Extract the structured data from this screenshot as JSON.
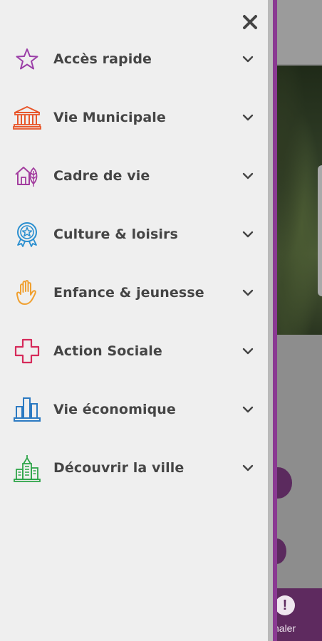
{
  "drawer": {
    "close_icon": "close-icon",
    "items": [
      {
        "label": "Accès rapide",
        "icon": "star-icon",
        "color": "#9b3ea7"
      },
      {
        "label": "Vie Municipale",
        "icon": "town-hall-icon",
        "color": "#e8562a"
      },
      {
        "label": "Cadre de vie",
        "icon": "house-leaf-icon",
        "color": "#a23c9e"
      },
      {
        "label": "Culture & loisirs",
        "icon": "rosette-icon",
        "color": "#2a8fd0"
      },
      {
        "label": "Enfance & jeunesse",
        "icon": "hand-icon",
        "color": "#f0a030"
      },
      {
        "label": "Action Sociale",
        "icon": "cross-icon",
        "color": "#d62a5a"
      },
      {
        "label": "Vie économique",
        "icon": "bar-chart-icon",
        "color": "#2b7ac2"
      },
      {
        "label": "Découvrir la ville",
        "icon": "city-buildings-icon",
        "color": "#2fa54a"
      }
    ]
  },
  "background": {
    "bottom_button_glyph": "!",
    "bottom_button_label": "naler",
    "accent_color": "#8a3a92"
  }
}
